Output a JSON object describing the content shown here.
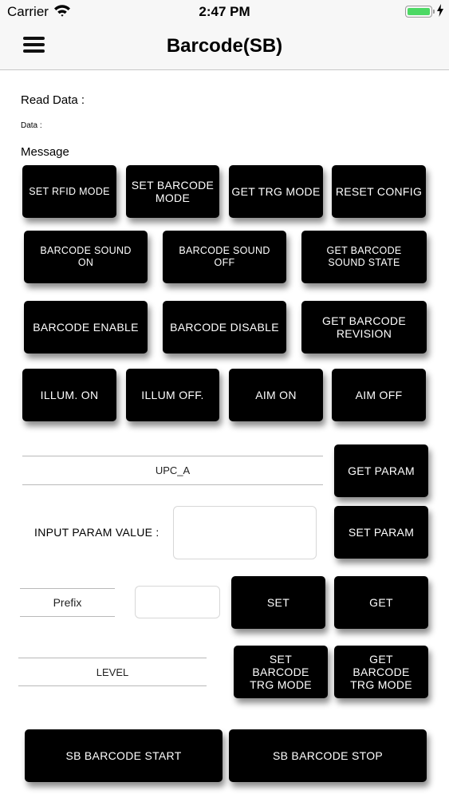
{
  "status_bar": {
    "carrier": "Carrier",
    "time": "2:47 PM"
  },
  "nav": {
    "title": "Barcode(SB)"
  },
  "labels": {
    "read_data": "Read Data :",
    "data": "Data :",
    "message": "Message"
  },
  "buttons": {
    "set_rfid_mode": "SET RFID MODE",
    "set_barcode_mode": "SET BARCODE MODE",
    "get_trg_mode": "GET TRG MODE",
    "reset_config": "RESET CONFIG",
    "barcode_sound_on": "BARCODE SOUND ON",
    "barcode_sound_off": "BARCODE SOUND OFF",
    "get_barcode_sound_state": "GET BARCODE SOUND STATE",
    "barcode_enable": "BARCODE ENABLE",
    "barcode_disable": "BARCODE DISABLE",
    "get_barcode_revision": "GET BARCODE REVISION",
    "illum_on": "ILLUM. ON",
    "illum_off": "ILLUM OFF.",
    "aim_on": "AIM ON",
    "aim_off": "AIM OFF",
    "get_param": "GET PARAM",
    "set_param": "SET PARAM",
    "set": "SET",
    "get": "GET",
    "set_barcode_trg_mode": "SET BARCODE TRG MODE",
    "get_barcode_trg_mode": "GET BARCODE TRG MODE",
    "sb_barcode_start": "SB BARCODE START",
    "sb_barcode_stop": "SB BARCODE STOP"
  },
  "fields": {
    "param_select": "UPC_A",
    "input_param_label": "INPUT PARAM VALUE :",
    "input_param_value": "",
    "prefix_select": "Prefix",
    "prefix_value": "",
    "level_select": "LEVEL"
  },
  "colors": {
    "button_bg": "#000000",
    "battery": "#4cd964"
  }
}
